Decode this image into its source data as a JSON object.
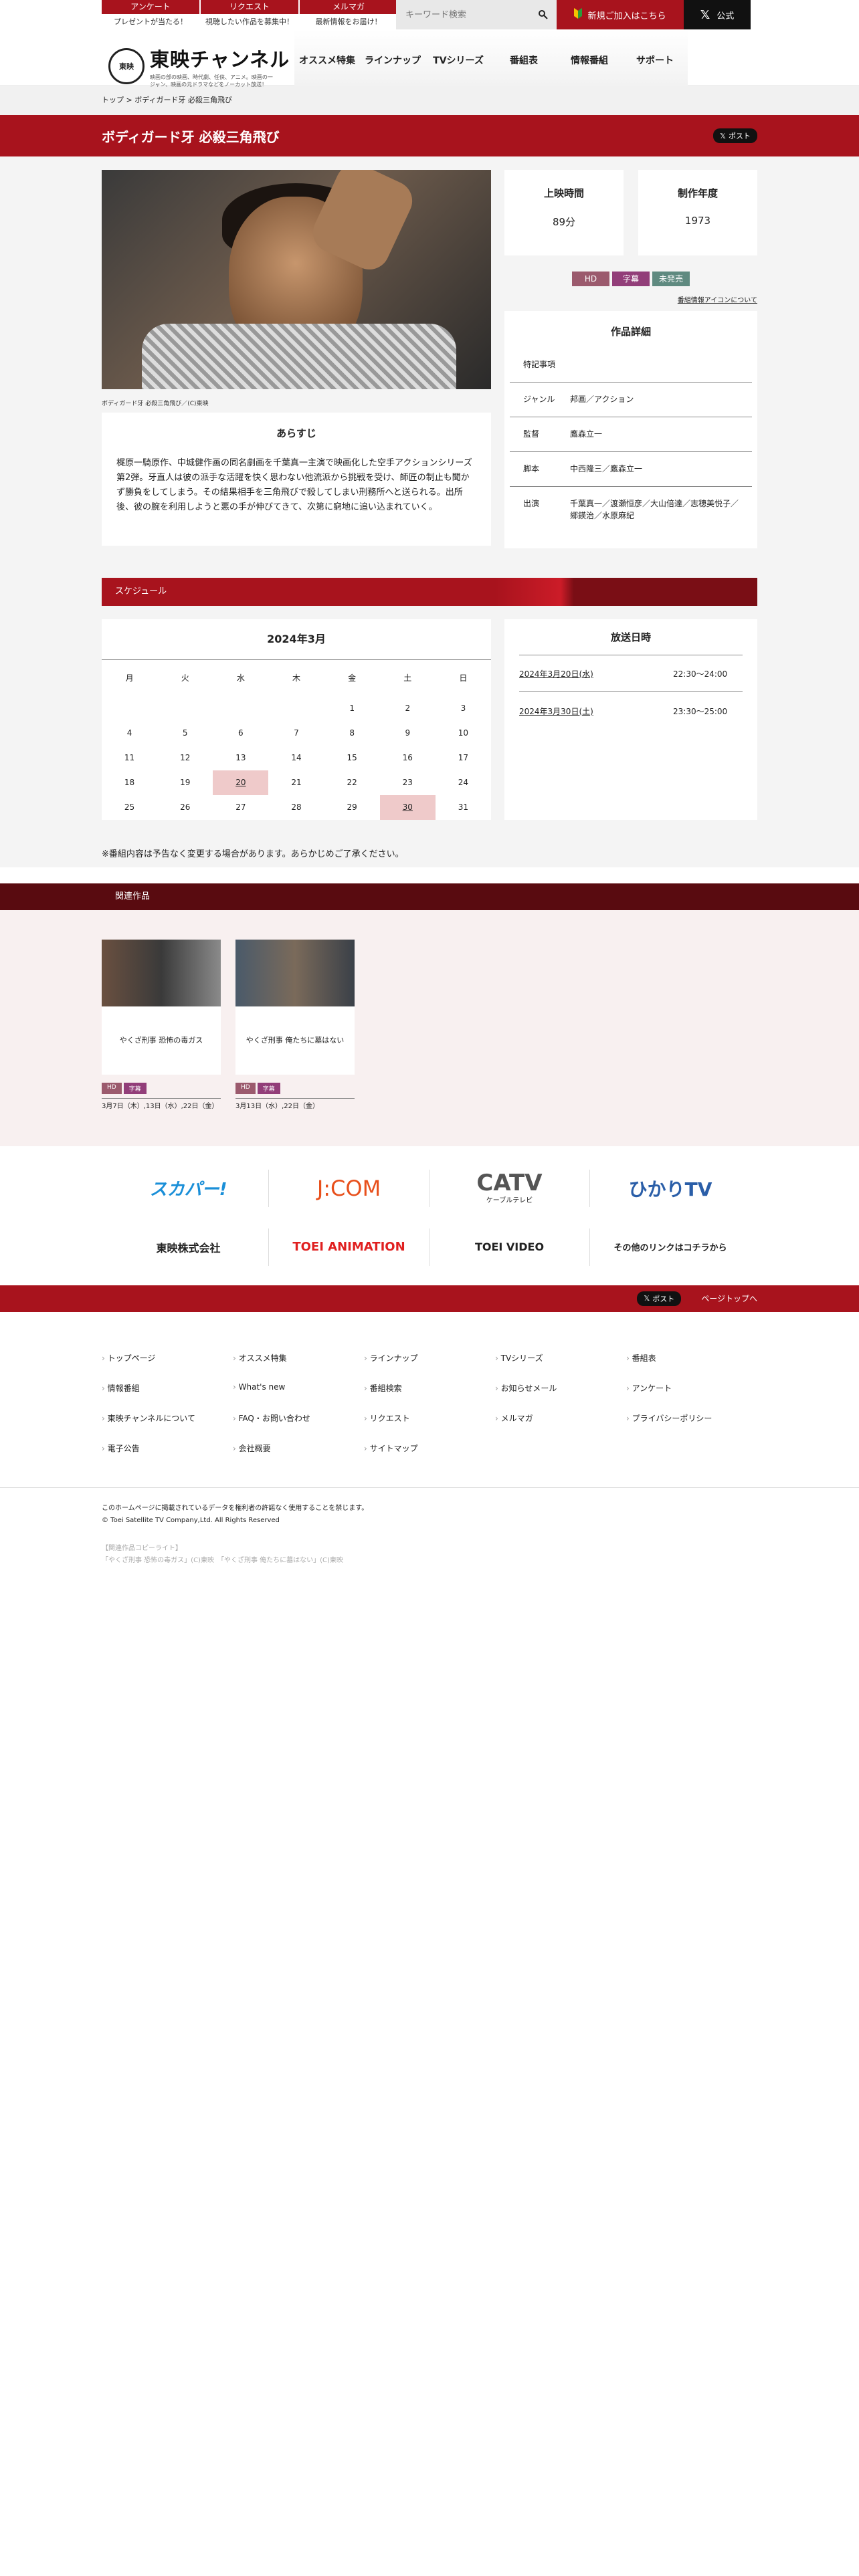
{
  "top_links": [
    {
      "label": "アンケート",
      "sub": "プレゼントが当たる！"
    },
    {
      "label": "リクエスト",
      "sub": "視聴したい作品を募集中！"
    },
    {
      "label": "メルマガ",
      "sub": "最新情報をお届け！"
    }
  ],
  "search": {
    "placeholder": "キーワード検索"
  },
  "join_label": "新規ご加入はこちら",
  "x_official_label": "公式",
  "logo": {
    "title": "東映チャンネル",
    "tagline": "映画の部の映画、時代劇、任侠、アニメ。映画の一ジャン、映画の元ドラマなどをノーカット放送！",
    "mark": "東映"
  },
  "gnav": [
    "オススメ特集",
    "ラインナップ",
    "TVシリーズ",
    "番組表",
    "情報番組",
    "サポート"
  ],
  "breadcrumb": {
    "home": "トップ",
    "sep": ">",
    "current": "ボディガード牙 必殺三角飛び"
  },
  "title": "ボディガード牙 必殺三角飛び",
  "post_label": "ポスト",
  "caption": "ボディガード牙 必殺三角飛び／(C)東映",
  "synopsis": {
    "heading": "あらすじ",
    "text": "梶原一騎原作、中城健作画の同名劇画を千葉真一主演で映画化した空手アクションシリーズ第2弾。牙直人は彼の派手な活躍を快く思わない他流派から挑戦を受け、師匠の制止も聞かず勝負をしてしまう。その結果相手を三角飛びで殺してしまい刑務所へと送られる。出所後、彼の腕を利用しようと悪の手が伸びてきて、次第に窮地に追い込まれていく。"
  },
  "runtime": {
    "label": "上映時間",
    "value": "89分"
  },
  "year": {
    "label": "制作年度",
    "value": "1973"
  },
  "badges": [
    {
      "label": "HD",
      "color": "#9b5a6d"
    },
    {
      "label": "字幕",
      "color": "#923e79"
    },
    {
      "label": "未発売",
      "color": "#5f8a80"
    }
  ],
  "icon_link": "番組情報アイコンについて",
  "detail": {
    "heading": "作品詳細",
    "rows": [
      {
        "k": "特記事項",
        "v": ""
      },
      {
        "k": "ジャンル",
        "v": "邦画／アクション"
      },
      {
        "k": "監督",
        "v": "鷹森立一"
      },
      {
        "k": "脚本",
        "v": "中西隆三／鷹森立一"
      },
      {
        "k": "出演",
        "v": "千葉真一／渡瀬恒彦／大山倍達／志穂美悦子／郷鍈治／水原麻紀"
      }
    ]
  },
  "schedule": {
    "heading": "スケジュール",
    "month": "2024年3月",
    "weekdays": [
      "月",
      "火",
      "水",
      "木",
      "金",
      "土",
      "日"
    ],
    "weeks": [
      [
        "",
        "",
        "",
        "",
        "1",
        "2",
        "3"
      ],
      [
        "4",
        "5",
        "6",
        "7",
        "8",
        "9",
        "10"
      ],
      [
        "11",
        "12",
        "13",
        "14",
        "15",
        "16",
        "17"
      ],
      [
        "18",
        "19",
        "20",
        "21",
        "22",
        "23",
        "24"
      ],
      [
        "25",
        "26",
        "27",
        "28",
        "29",
        "30",
        "31"
      ]
    ],
    "highlight": [
      "20",
      "30"
    ]
  },
  "airing": {
    "heading": "放送日時",
    "rows": [
      {
        "date": "2024年3月20日(水)",
        "time": "22:30〜24:00"
      },
      {
        "date": "2024年3月30日(土)",
        "time": "23:30〜25:00"
      }
    ]
  },
  "notice": "※番組内容は予告なく変更する場合があります。あらかじめご了承ください。",
  "related": {
    "heading": "関連作品",
    "items": [
      {
        "title": "やくざ刑事 恐怖の毒ガス",
        "badges": [
          "HD",
          "字幕"
        ],
        "dates": "3月7日（木）,13日（水）,22日（金）"
      },
      {
        "title": "やくざ刑事 俺たちに墓はない",
        "badges": [
          "HD",
          "字幕"
        ],
        "dates": "3月13日（水）,22日（金）"
      }
    ]
  },
  "banners": {
    "row1": [
      "スカパー!",
      "J:COM",
      "CATV",
      "ひかりTV"
    ],
    "catv_sub": "ケーブルテレビ",
    "row2": [
      "東映株式会社",
      "TOEI ANIMATION",
      "TOEI VIDEO",
      "その他のリンクはコチラから"
    ]
  },
  "pagetop": "ページトップへ",
  "footer_nav": [
    "トップページ",
    "オススメ特集",
    "ラインナップ",
    "TVシリーズ",
    "番組表",
    "情報番組",
    "What's new",
    "番組検索",
    "お知らせメール",
    "アンケート",
    "東映チャンネルについて",
    "FAQ・お問い合わせ",
    "リクエスト",
    "メルマガ",
    "プライバシーポリシー",
    "電子公告",
    "会社概要",
    "サイトマップ"
  ],
  "copyright": {
    "l1": "このホームページに掲載されているデータを権利者の許諾なく使用することを禁じます。",
    "l2": "© Toei Satellite TV Company,Ltd. All Rights Reserved",
    "rel1": "【関連作品コピーライト】",
    "rel2": "「やくざ刑事 恐怖の毒ガス」(C)東映　「やくざ刑事 俺たちに墓はない」(C)東映"
  }
}
